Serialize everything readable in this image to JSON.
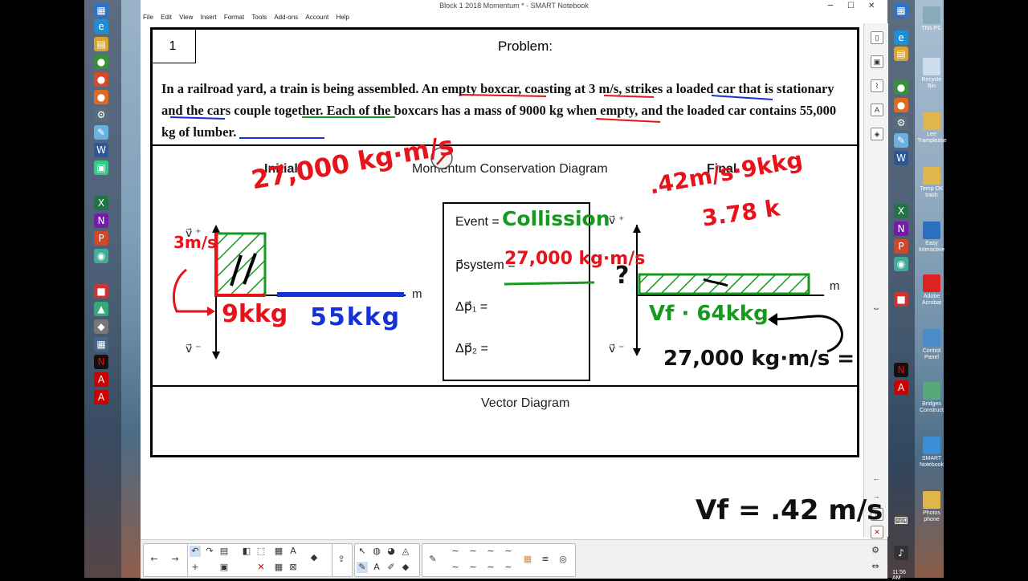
{
  "window": {
    "title": "Block 1 2018 Momentum * - SMART Notebook"
  },
  "menu": [
    "File",
    "Edit",
    "View",
    "Insert",
    "Format",
    "Tools",
    "Add-ons",
    "Account",
    "Help"
  ],
  "problem": {
    "number": "1",
    "heading": "Problem:",
    "text": "In a railroad yard, a train is being assembled. An empty boxcar, coasting at 3 m/s, strikes a loaded car that is stationary and the cars couple together. Each of the boxcars has a mass of 9000 kg when empty, and the loaded car contains 55,000 kg of lumber."
  },
  "diagram": {
    "title": "Momentum Conservation Diagram",
    "initial_label": "Initial",
    "final_label": "Final",
    "v_plus": "v⃗ ⁺",
    "v_minus": "v⃗ ⁻",
    "axis_m": "m",
    "event_label": "Event =",
    "p_system_label": "p⃗system =",
    "dp1_label": "Δp⃗₁ =",
    "dp2_label": "Δp⃗₂ =",
    "vector_title": "Vector Diagram"
  },
  "handwriting": {
    "initial_momentum": "27,000 kg·m/s",
    "initial_v": "3m/s",
    "mass1": "9kkg",
    "mass2": "55kkg",
    "event": "Collission",
    "p_system": "27,000 kg·m/s",
    "question": "?",
    "final_calc1": ".42m/s·9kkg",
    "final_calc2": "3.78 k",
    "vf_eq": "Vf · 64kkg",
    "final_p": "27,000 kg·m/s =",
    "answer": "Vf = .42 m/s"
  },
  "colors": {
    "red": "#e8121b",
    "green": "#169a1e",
    "blue": "#1432d8",
    "black": "#000000"
  },
  "taskbar_right": {
    "items": [
      "This PC",
      "Recycle Bin",
      "Lee Tramplease",
      "Temp OK trash",
      "Easy Interactive",
      "Adobe Acrobat",
      "Control Panel",
      "Bridges Construct",
      "SMART Notebook",
      "Photos phone"
    ],
    "clock": "11:56 AM"
  }
}
